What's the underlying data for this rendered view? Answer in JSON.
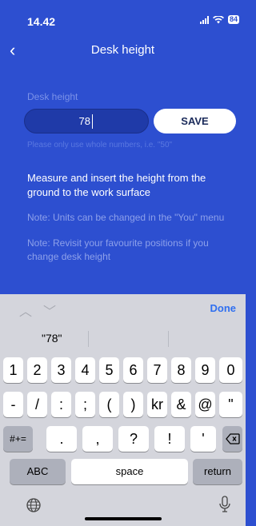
{
  "status_bar": {
    "time": "14.42",
    "battery": "84"
  },
  "nav": {
    "title": "Desk height"
  },
  "form": {
    "label": "Desk height",
    "value": "78",
    "save_label": "SAVE",
    "hint": "Please only use whole numbers, i.e. \"50\""
  },
  "info": {
    "measure": "Measure and insert the height from the ground to the work surface",
    "note_units": "Note: Units can be changed in the \"You\" menu",
    "note_positions": "Note: Revisit your favourite positions if you change desk height"
  },
  "accessory": {
    "done_label": "Done"
  },
  "keyboard": {
    "suggestion": "\"78\"",
    "row1": [
      "1",
      "2",
      "3",
      "4",
      "5",
      "6",
      "7",
      "8",
      "9",
      "0"
    ],
    "row2": [
      "-",
      "/",
      ":",
      ";",
      "(",
      ")",
      "kr",
      "&",
      "@",
      "\""
    ],
    "row3_mode": "#+=",
    "row3": [
      ".",
      ",",
      "?",
      "!",
      "'"
    ],
    "abc": "ABC",
    "space": "space",
    "return": "return"
  }
}
